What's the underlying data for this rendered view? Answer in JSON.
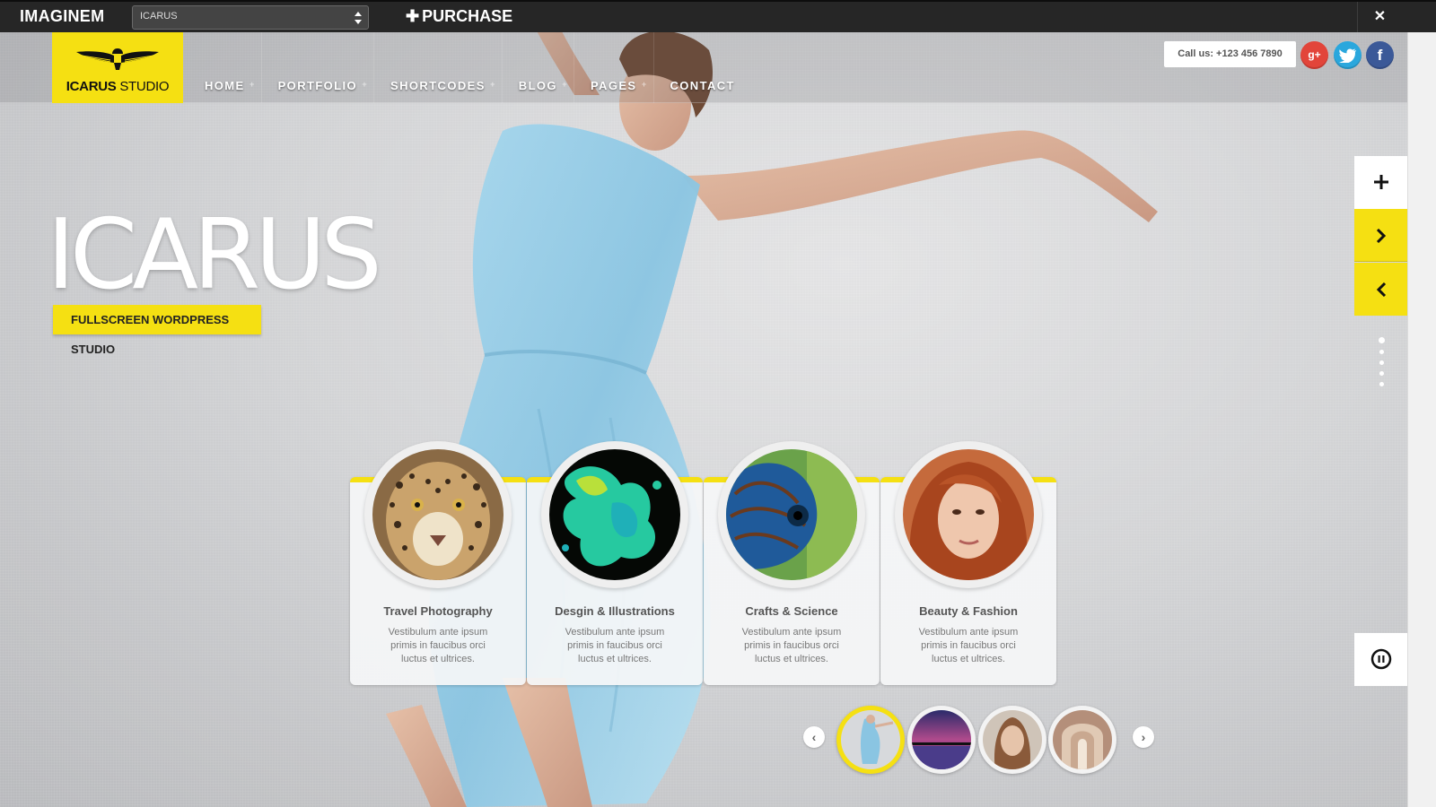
{
  "demo_bar": {
    "brand": "IMAGINEM",
    "theme_select": "ICARUS",
    "purchase_label": "PURCHASE",
    "close_label": "✕"
  },
  "header": {
    "logo_bold": "ICARUS",
    "logo_light": "STUDIO",
    "nav": [
      {
        "label": "HOME",
        "has_sub": true
      },
      {
        "label": "PORTFOLIO",
        "has_sub": true
      },
      {
        "label": "SHORTCODES",
        "has_sub": true
      },
      {
        "label": "BLOG",
        "has_sub": true
      },
      {
        "label": "PAGES",
        "has_sub": true
      },
      {
        "label": "CONTACT",
        "has_sub": false
      }
    ],
    "sub_marker": "+",
    "call_us": "Call us: +123 456 7890",
    "social": [
      {
        "name": "google-plus",
        "glyph": "g+",
        "color": "#e2453a"
      },
      {
        "name": "twitter",
        "glyph": "t",
        "color": "#2aa7dd"
      },
      {
        "name": "facebook",
        "glyph": "f",
        "color": "#3b5998"
      }
    ]
  },
  "hero": {
    "title": "ICARUS",
    "tagline": "FULLSCREEN WORDPRESS STUDIO"
  },
  "side_controls": {
    "plus": "+",
    "next": "›",
    "prev": "‹",
    "dots_count": 5,
    "active_dot": 0
  },
  "cards": [
    {
      "title": "Travel Photography",
      "text": "Vestibulum ante ipsum primis in faucibus orci luctus et ultrices.",
      "image": "leopard"
    },
    {
      "title": "Desgin & Illustrations",
      "text": "Vestibulum ante ipsum primis in faucibus orci luctus et ultrices.",
      "image": "paint-splash"
    },
    {
      "title": "Crafts & Science",
      "text": "Vestibulum ante ipsum primis in faucibus orci luctus et ultrices.",
      "image": "fish"
    },
    {
      "title": "Beauty & Fashion",
      "text": "Vestibulum ante ipsum primis in faucibus orci luctus et ultrices.",
      "image": "woman-portrait"
    }
  ],
  "thumbnails": [
    {
      "image": "dancer",
      "active": true
    },
    {
      "image": "pier-sunset",
      "active": false
    },
    {
      "image": "portrait",
      "active": false
    },
    {
      "image": "arched-corridor",
      "active": false
    }
  ],
  "colors": {
    "accent": "#f5e012",
    "topbar": "#262626"
  }
}
